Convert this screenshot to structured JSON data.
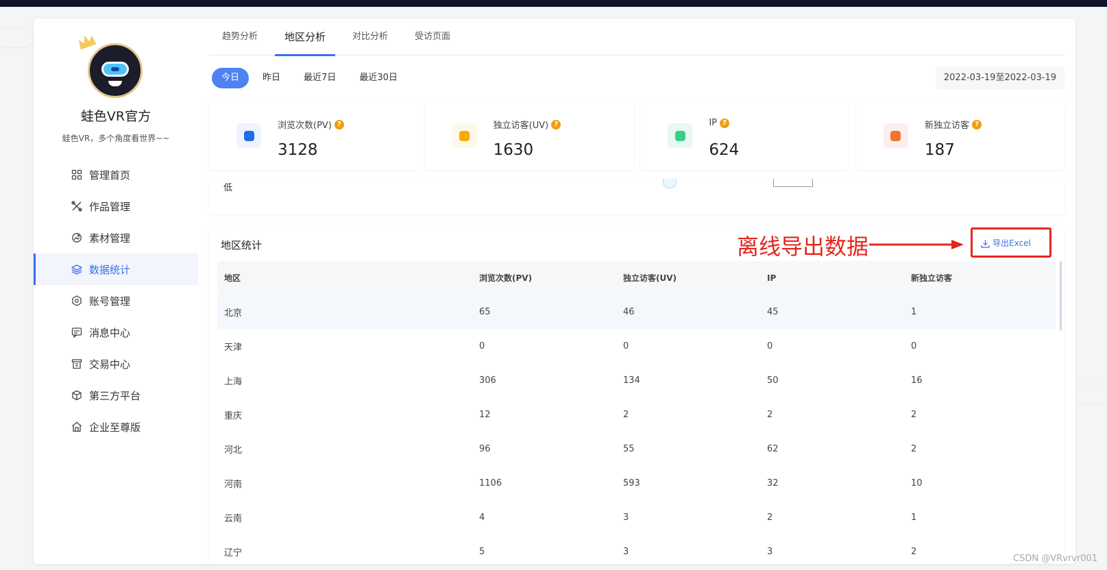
{
  "sidebar": {
    "brand_name": "蛙色VR官方",
    "brand_sub": "蛙色VR，多个角度看世界~~",
    "items": [
      {
        "label": "管理首页",
        "icon": "grid-icon"
      },
      {
        "label": "作品管理",
        "icon": "tools-icon"
      },
      {
        "label": "素材管理",
        "icon": "photos-icon"
      },
      {
        "label": "数据统计",
        "icon": "layers-icon",
        "active": true
      },
      {
        "label": "账号管理",
        "icon": "gear-icon"
      },
      {
        "label": "消息中心",
        "icon": "message-icon"
      },
      {
        "label": "交易中心",
        "icon": "receipt-icon"
      },
      {
        "label": "第三方平台",
        "icon": "cube-icon"
      },
      {
        "label": "企业至尊版",
        "icon": "building-icon"
      }
    ]
  },
  "tabs": [
    "趋势分析",
    "地区分析",
    "对比分析",
    "受访页面"
  ],
  "active_tab": "地区分析",
  "filters": [
    "今日",
    "昨日",
    "最近7日",
    "最近30日"
  ],
  "active_filter": "今日",
  "date_range": "2022-03-19至2022-03-19",
  "stats": [
    {
      "label": "浏览次数(PV)",
      "value": "3128",
      "color": "#1f6bf2",
      "bg": "#eef3fd"
    },
    {
      "label": "独立访客(UV)",
      "value": "1630",
      "color": "#f5ad0b",
      "bg": "#fef8ea"
    },
    {
      "label": "IP",
      "value": "624",
      "color": "#36d08e",
      "bg": "#e9f8f1"
    },
    {
      "label": "新独立访客",
      "value": "187",
      "color": "#f27332",
      "bg": "#fdeeee"
    }
  ],
  "map_legend_low": "低",
  "region": {
    "title": "地区统计",
    "annotation": "离线导出数据",
    "export_label": "导出Excel",
    "columns": [
      "地区",
      "浏览次数(PV)",
      "独立访客(UV)",
      "IP",
      "新独立访客"
    ],
    "rows": [
      [
        "北京",
        "65",
        "46",
        "45",
        "1"
      ],
      [
        "天津",
        "0",
        "0",
        "0",
        "0"
      ],
      [
        "上海",
        "306",
        "134",
        "50",
        "16"
      ],
      [
        "重庆",
        "12",
        "2",
        "2",
        "2"
      ],
      [
        "河北",
        "96",
        "55",
        "62",
        "2"
      ],
      [
        "河南",
        "1106",
        "593",
        "32",
        "10"
      ],
      [
        "云南",
        "4",
        "3",
        "2",
        "1"
      ],
      [
        "辽宁",
        "5",
        "3",
        "3",
        "2"
      ]
    ]
  },
  "watermark": "CSDN @VRvrvr001",
  "colors": {
    "accent": "#3b6fe8",
    "annotation": "#e5261e",
    "help": "#f39c12"
  }
}
